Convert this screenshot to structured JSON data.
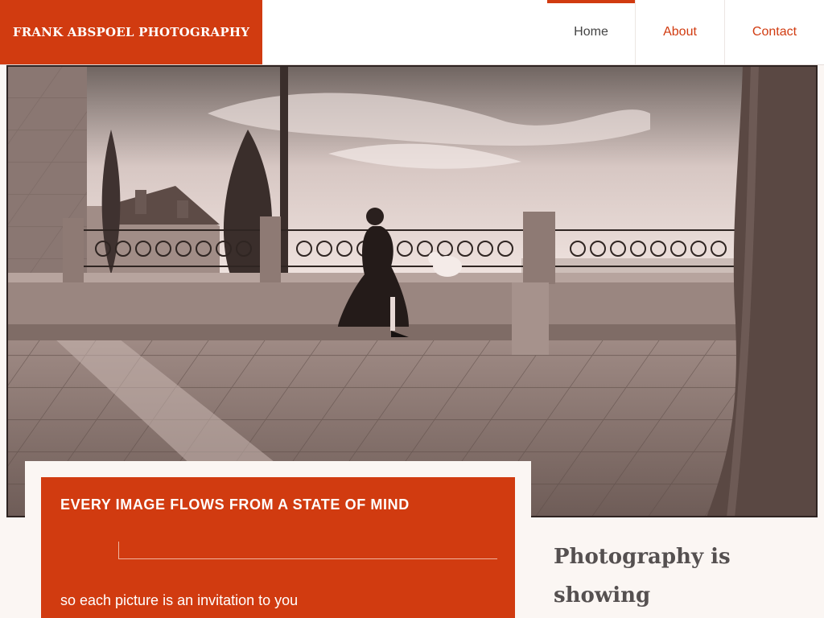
{
  "header": {
    "brand": "FRANK ABSPOEL PHOTOGRAPHY",
    "nav": [
      {
        "label": "Home",
        "active": true
      },
      {
        "label": "About",
        "active": false
      },
      {
        "label": "Contact",
        "active": false
      }
    ]
  },
  "hero": {
    "image": "sepia photograph of a woman sitting on a stone balustrade with a small white dog, overlooking a valley"
  },
  "intro": {
    "title": "EVERY IMAGE FLOWS FROM A STATE OF MIND",
    "text": "so each picture is an invitation to you"
  },
  "side": {
    "heading": "Photography is showing"
  },
  "colors": {
    "accent": "#d13b10",
    "background": "#fbf6f3",
    "text_dark": "#555050"
  }
}
